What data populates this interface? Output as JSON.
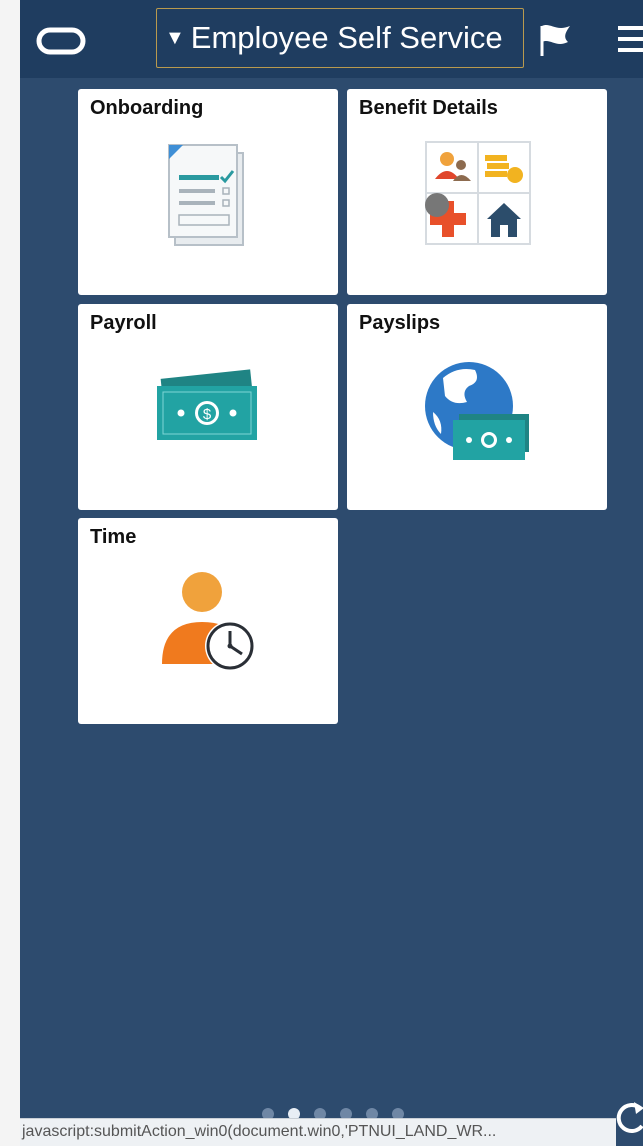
{
  "header": {
    "title": "Employee Self Service",
    "caret_glyph": "▼",
    "logo_icon": "oracle-oval-icon",
    "flag_icon": "flag-icon",
    "menu_icon": "hamburger-menu-icon"
  },
  "tiles": [
    {
      "title": "Onboarding",
      "icon": "checklist-document-icon"
    },
    {
      "title": "Benefit Details",
      "icon": "benefits-grid-icon"
    },
    {
      "title": "Payroll",
      "icon": "banknotes-icon"
    },
    {
      "title": "Payslips",
      "icon": "globe-money-icon"
    },
    {
      "title": "Time",
      "icon": "person-clock-icon"
    }
  ],
  "pager": {
    "total_pages": 6,
    "active_page": 2
  },
  "status_bar": {
    "text": "javascript:submitAction_win0(document.win0,'PTNUI_LAND_WR..."
  },
  "colors": {
    "page_background": "#2d4b6e",
    "header_background": "#1f3d60",
    "title_border": "#b99a4e",
    "teal": "#20a0a0",
    "orange": "#f08a1e"
  }
}
